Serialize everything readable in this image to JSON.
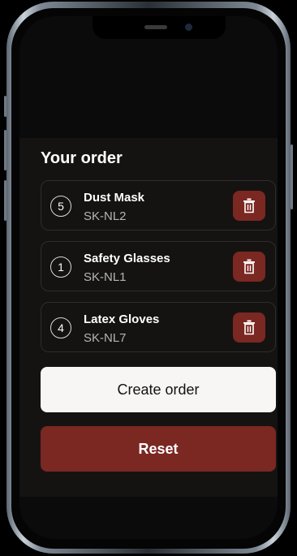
{
  "order": {
    "title": "Your order",
    "items": [
      {
        "qty": "5",
        "name": "Dust Mask",
        "sku": "SK-NL2"
      },
      {
        "qty": "1",
        "name": "Safety Glasses",
        "sku": "SK-NL1"
      },
      {
        "qty": "4",
        "name": "Latex Gloves",
        "sku": "SK-NL7"
      }
    ],
    "create_label": "Create order",
    "reset_label": "Reset"
  },
  "icons": {
    "delete": "trash-icon"
  },
  "colors": {
    "accent": "#7b2722",
    "sheet": "#141312",
    "primary_button": "#f7f6f4"
  }
}
